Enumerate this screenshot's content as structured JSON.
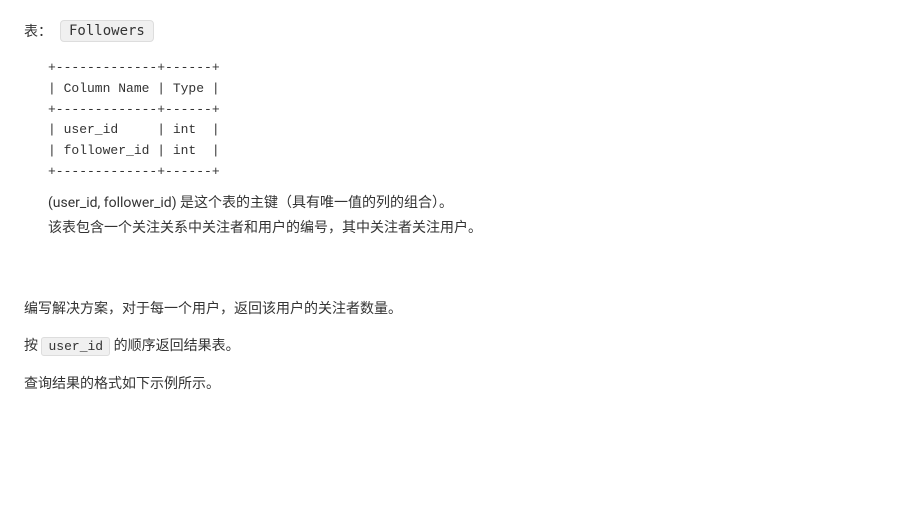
{
  "header": {
    "label": "表：",
    "table_name": "Followers"
  },
  "schema": {
    "border_top": "+-------------+------+",
    "header_row": "| Column Name | Type |",
    "border_mid": "+-------------+------+",
    "row1": "| user_id     | int  |",
    "row2": "| follower_id | int  |",
    "border_bot": "+-------------+------+"
  },
  "description": {
    "line1": "(user_id, follower_id) 是这个表的主键（具有唯一值的列的组合）。",
    "line2": "该表包含一个关注关系中关注者和用户的编号，其中关注者关注用户。"
  },
  "task": {
    "paragraph1": "编写解决方案，对于每一个用户，返回该用户的关注者数量。",
    "paragraph2_prefix": "按 ",
    "paragraph2_code": "user_id",
    "paragraph2_suffix": " 的顺序返回结果表。",
    "paragraph3": "查询结果的格式如下示例所示。"
  }
}
